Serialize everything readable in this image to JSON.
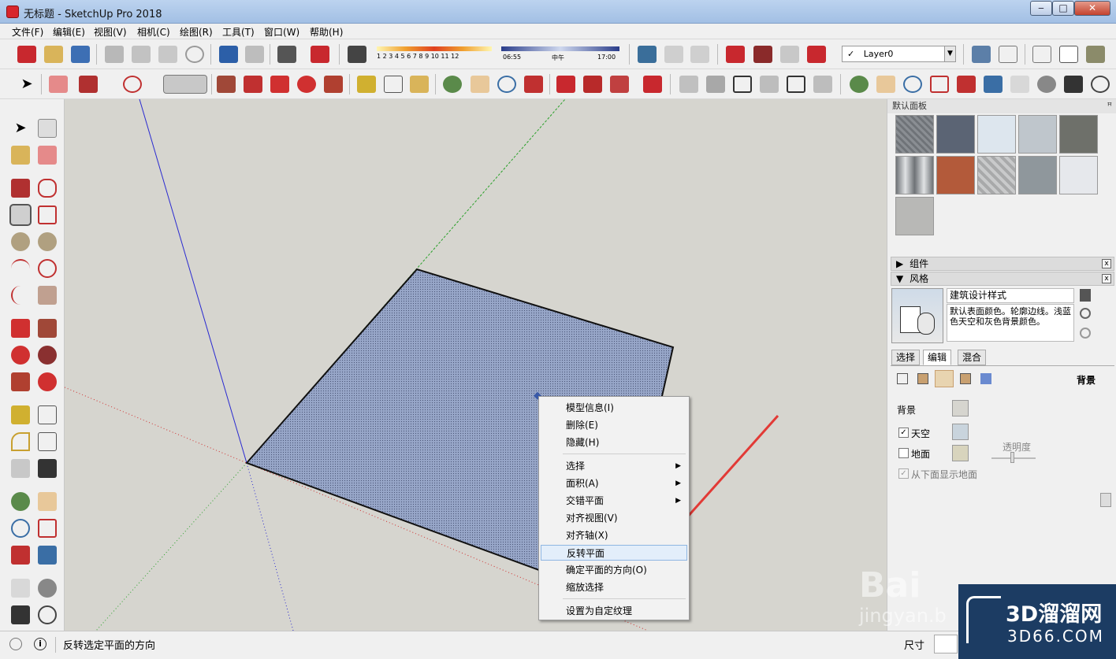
{
  "window": {
    "title": "无标题 - SketchUp Pro 2018",
    "minimize": "‒",
    "maximize": "□",
    "close": "✕"
  },
  "menu": [
    "文件(F)",
    "编辑(E)",
    "视图(V)",
    "相机(C)",
    "绘图(R)",
    "工具(T)",
    "窗口(W)",
    "帮助(H)"
  ],
  "shadow": {
    "months": "1 2 3 4 5 6 7 8 9 10 11 12",
    "time_start": "06:55",
    "time_mid": "中午",
    "time_end": "17:00"
  },
  "layer": {
    "check": "✓",
    "name": "Layer0",
    "arrow": "▼"
  },
  "context_menu": [
    {
      "label": "模型信息(I)",
      "submenu": false
    },
    {
      "label": "删除(E)",
      "submenu": false
    },
    {
      "label": "隐藏(H)",
      "submenu": false
    },
    {
      "label": "选择",
      "submenu": true
    },
    {
      "label": "面积(A)",
      "submenu": true
    },
    {
      "label": "交错平面",
      "submenu": true
    },
    {
      "label": "对齐视图(V)",
      "submenu": false
    },
    {
      "label": "对齐轴(X)",
      "submenu": false
    },
    {
      "label": "反转平面",
      "submenu": false,
      "highlighted": true
    },
    {
      "label": "确定平面的方向(O)",
      "submenu": false
    },
    {
      "label": "缩放选择",
      "submenu": false
    },
    {
      "label": "设置为自定纹理",
      "submenu": false
    }
  ],
  "submenu_arrow": "▶",
  "panel": {
    "title": "默认面板",
    "pin": "ꟸ",
    "materials_colors": [
      "#8a8e93",
      "#5b6474",
      "#dde6ee",
      "#bfc6cc",
      "#6e706a",
      "#9ea2a4",
      "#b35a3a",
      "#c9cacb",
      "#8f979c",
      "#e6e8ec",
      "#b8b8b6"
    ],
    "components": {
      "label": "组件",
      "toggle": "▶",
      "close": "x"
    },
    "styles": {
      "label": "风格",
      "toggle": "▼",
      "close": "x",
      "style_name": "建筑设计样式",
      "description": "默认表面颜色。轮廓边线。浅蓝色天空和灰色背景颜色。",
      "tabs": [
        "选择",
        "编辑",
        "混合"
      ],
      "active_tab": "编辑",
      "section": "背景",
      "background_label": "背景",
      "sky_label": "天空",
      "sky_checked": true,
      "ground_label": "地面",
      "ground_checked": false,
      "transparency_label": "透明度",
      "show_ground_below_label": "从下面显示地面",
      "show_ground_below_checked": true,
      "colors": {
        "background": "#d6d5cf",
        "sky": "#c9d4dd",
        "ground": "#d8d4bd"
      }
    }
  },
  "status": {
    "hint": "反转选定平面的方向",
    "measure_label": "尺寸"
  },
  "watermark": {
    "brand": "Bai",
    "sub": "jingyan.b",
    "site_name": "3D溜溜网",
    "site_url": "3D66.COM"
  },
  "colors": {
    "face": "#97a6c8",
    "menu_highlight": "#e3eefa",
    "title_bar": "#b9d1ee",
    "arrow": "#e23a36"
  }
}
